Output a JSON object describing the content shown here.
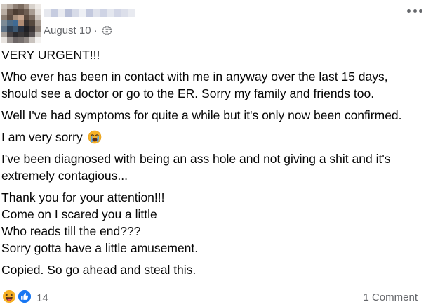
{
  "post": {
    "date": "August 10",
    "separator": "·",
    "privacy_icon": "globe-icon",
    "menu_icon": "more-options-icon"
  },
  "content": {
    "p1": "VERY URGENT!!!",
    "p2": "Who ever has been in contact with me in anyway over the last 15 days, should see a doctor or go to the ER. Sorry my family and friends too.",
    "p3": "Well I've had symptoms for quite a while but it's only now been confirmed.",
    "p4": "I am very sorry",
    "p4_emoji": "crying-face-emoji",
    "p5": "I've been diagnosed with being an ass hole and not giving a shit and it's extremely contagious...",
    "p6_lines": [
      "Thank you for your attention!!!",
      "Come on I scared you a little",
      "Who reads till the end???",
      "Sorry gotta have a little amusement."
    ],
    "p7": "Copied. So go ahead and steal this."
  },
  "footer": {
    "reactions": [
      "haha",
      "like"
    ],
    "reaction_count": "14",
    "comments": "1 Comment"
  },
  "colors": {
    "text": "#050505",
    "secondary": "#65676b",
    "like_blue": "#1877f2",
    "haha_yellow": "#f7b125"
  }
}
